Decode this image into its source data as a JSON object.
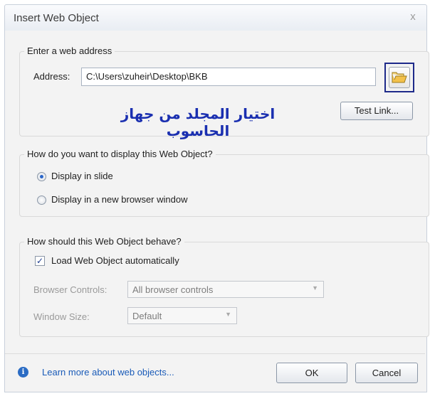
{
  "window": {
    "title": "Insert Web Object",
    "close_glyph": "x"
  },
  "address_group": {
    "legend": "Enter a web address",
    "address_label": "Address:",
    "address_value": "C:\\Users\\zuheir\\Desktop\\BKB",
    "browse_icon": "folder-icon",
    "test_link_label": "Test Link...",
    "annotation": "اختيار المجلد من جهاز الحاسوب",
    "annotation_color": "#1a2fb0",
    "highlight_color": "#1e2a8a"
  },
  "display_group": {
    "legend": "How do you want to display this Web Object?",
    "options": [
      {
        "label": "Display in slide",
        "selected": true
      },
      {
        "label": "Display in a new browser window",
        "selected": false
      }
    ]
  },
  "behave_group": {
    "legend": "How should this Web Object behave?",
    "load_auto_label": "Load Web Object automatically",
    "load_auto_checked": true,
    "browser_controls_label": "Browser Controls:",
    "browser_controls_value": "All browser controls",
    "window_size_label": "Window Size:",
    "window_size_value": "Default"
  },
  "footer": {
    "info_icon": "info-icon",
    "learn_more": "Learn more about web objects...",
    "ok_label": "OK",
    "cancel_label": "Cancel"
  }
}
